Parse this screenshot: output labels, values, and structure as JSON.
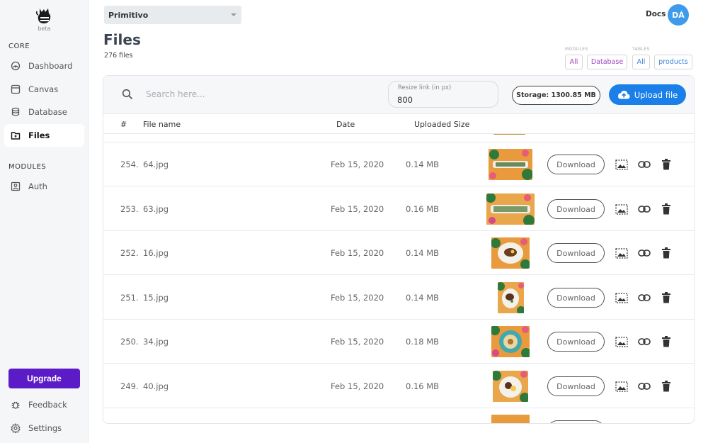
{
  "sidebar": {
    "logo_badge": "beta",
    "core_label": "CORE",
    "core_items": [
      {
        "label": "Dashboard",
        "icon": "dashboard-icon"
      },
      {
        "label": "Canvas",
        "icon": "canvas-icon"
      },
      {
        "label": "Database",
        "icon": "database-icon"
      },
      {
        "label": "Files",
        "icon": "files-icon",
        "active": true
      }
    ],
    "modules_label": "MODULES",
    "module_items": [
      {
        "label": "Auth",
        "icon": "auth-icon"
      }
    ],
    "upgrade_label": "Upgrade",
    "footer_items": [
      {
        "label": "Feedback",
        "icon": "bug-icon"
      },
      {
        "label": "Settings",
        "icon": "gear-icon"
      }
    ]
  },
  "header": {
    "project": "Primitivo",
    "docs_label": "Docs",
    "avatar_initials": "DÁ"
  },
  "page": {
    "title": "Files",
    "count": "276 files"
  },
  "filters": {
    "modules_label": "MODULES",
    "modules": [
      "All",
      "Database"
    ],
    "tables_label": "TABLES",
    "tables": [
      "All",
      "products"
    ]
  },
  "toolbar": {
    "search_placeholder": "Search here...",
    "resize_label": "Resize link (in px)",
    "resize_value": "800",
    "storage": "Storage: 1300.85 MB",
    "upload_label": "Upload file"
  },
  "table": {
    "columns": [
      "#",
      "File name",
      "Date",
      "Uploaded Size"
    ],
    "download_label": "Download",
    "rows": [
      {
        "index": "254.",
        "name": "64.jpg",
        "date": "Feb 15, 2020",
        "size": "0.14 MB"
      },
      {
        "index": "253.",
        "name": "63.jpg",
        "date": "Feb 15, 2020",
        "size": "0.16 MB"
      },
      {
        "index": "252.",
        "name": "16.jpg",
        "date": "Feb 15, 2020",
        "size": "0.14 MB"
      },
      {
        "index": "251.",
        "name": "15.jpg",
        "date": "Feb 15, 2020",
        "size": "0.14 MB"
      },
      {
        "index": "250.",
        "name": "34.jpg",
        "date": "Feb 15, 2020",
        "size": "0.18 MB"
      },
      {
        "index": "249.",
        "name": "40.jpg",
        "date": "Feb 15, 2020",
        "size": "0.16 MB"
      }
    ]
  },
  "colors": {
    "accent_blue": "#1a7fe8",
    "upgrade_purple": "#5b1bc7",
    "avatar": "#3d9be9"
  }
}
